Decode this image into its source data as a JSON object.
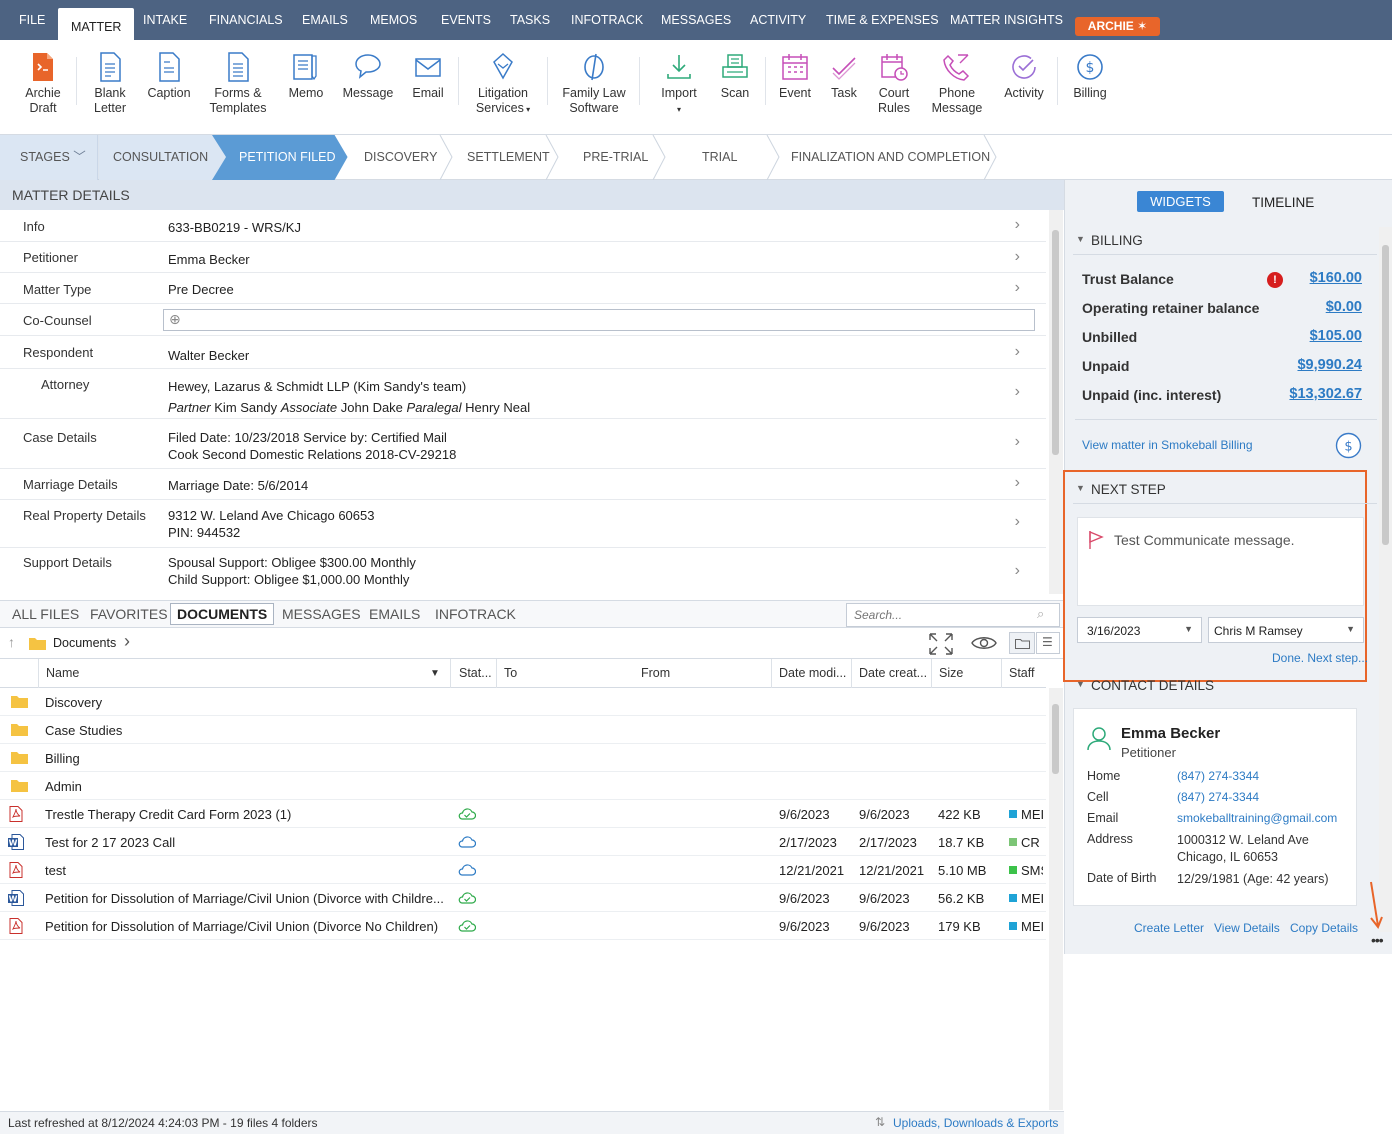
{
  "menu": {
    "tabs": [
      "FILE",
      "MATTER",
      "INTAKE",
      "FINANCIALS",
      "EMAILS",
      "MEMOS",
      "EVENTS",
      "TASKS",
      "INFOTRACK",
      "MESSAGES",
      "ACTIVITY",
      "TIME & EXPENSES",
      "MATTER INSIGHTS"
    ],
    "active": "MATTER",
    "archie": "ARCHIE"
  },
  "ribbon": {
    "archie_draft": [
      "Archie",
      "Draft"
    ],
    "blank_letter": [
      "Blank",
      "Letter"
    ],
    "caption": [
      "Caption",
      ""
    ],
    "forms_templates": [
      "Forms &",
      "Templates"
    ],
    "memo": [
      "Memo",
      ""
    ],
    "message": [
      "Message",
      ""
    ],
    "email": [
      "Email",
      ""
    ],
    "litigation_services": [
      "Litigation",
      "Services"
    ],
    "family_law_software": [
      "Family Law",
      "Software"
    ],
    "import": [
      "Import",
      ""
    ],
    "scan": [
      "Scan",
      ""
    ],
    "event": [
      "Event",
      ""
    ],
    "task": [
      "Task",
      ""
    ],
    "court_rules": [
      "Court",
      "Rules"
    ],
    "phone_message": [
      "Phone",
      "Message"
    ],
    "activity": [
      "Activity",
      ""
    ],
    "billing": [
      "Billing",
      ""
    ]
  },
  "stages": {
    "label": "STAGES",
    "items": [
      "CONSULTATION",
      "PETITION FILED",
      "DISCOVERY",
      "SETTLEMENT",
      "PRE-TRIAL",
      "TRIAL",
      "FINALIZATION AND COMPLETION"
    ],
    "active": "PETITION FILED"
  },
  "matter": {
    "header": "MATTER DETAILS",
    "info": {
      "label": "Info",
      "value": "633-BB0219 - WRS/KJ"
    },
    "petitioner": {
      "label": "Petitioner",
      "value": "Emma Becker"
    },
    "matter_type": {
      "label": "Matter Type",
      "value": "Pre Decree"
    },
    "co_counsel": {
      "label": "Co-Counsel"
    },
    "respondent": {
      "label": "Respondent",
      "value": "Walter Becker"
    },
    "attorney": {
      "label": "Attorney",
      "firm": "Hewey, Lazarus & Schmidt LLP (Kim Sandy's team)",
      "r1": "Partner",
      "n1": "Kim Sandy",
      "r2": "Associate",
      "n2": "John Dake",
      "r3": "Paralegal",
      "n3": "Henry Neal"
    },
    "case_details": {
      "label": "Case Details",
      "line1": "Filed Date: 10/23/2018  Service by: Certified Mail",
      "line2": "Cook Second Domestic Relations 2018-CV-29218"
    },
    "marriage_details": {
      "label": "Marriage Details",
      "value": "Marriage Date: 5/6/2014"
    },
    "real_property": {
      "label": "Real Property Details",
      "line1": "9312 W. Leland Ave Chicago 60653",
      "line2": "PIN: 944532"
    },
    "support": {
      "label": "Support Details",
      "line1": "Spousal Support: Obligee $300.00 Monthly",
      "line2": "Child Support: Obligee $1,000.00 Monthly"
    }
  },
  "files": {
    "tabs": [
      "ALL FILES",
      "FAVORITES",
      "DOCUMENTS",
      "MESSAGES",
      "EMAILS",
      "INFOTRACK"
    ],
    "active": "DOCUMENTS",
    "search_placeholder": "Search...",
    "crumb": "Documents",
    "columns": {
      "name": "Name",
      "status": "Stat...",
      "to": "To",
      "from": "From",
      "modified": "Date modi...",
      "created": "Date creat...",
      "size": "Size",
      "staff": "Staff"
    },
    "folders": [
      "Discovery",
      "Case Studies",
      "Billing",
      "Admin"
    ],
    "rows": [
      {
        "type": "pdf",
        "name": "Trestle Therapy Credit Card Form 2023 (1)",
        "status": "synced",
        "modified": "9/6/2023",
        "created": "9/6/2023",
        "size": "422 KB",
        "staff": "MEI",
        "staff_color": "#1fa3d6"
      },
      {
        "type": "word",
        "name": "Test for 2 17 2023 Call",
        "status": "cloud",
        "modified": "2/17/2023",
        "created": "2/17/2023",
        "size": "18.7 KB",
        "staff": "CR",
        "staff_color": "#7cc576"
      },
      {
        "type": "pdf",
        "name": "test",
        "status": "cloud",
        "modified": "12/21/2021",
        "created": "12/21/2021",
        "size": "5.10 MB",
        "staff": "SMS",
        "staff_color": "#3cc24a"
      },
      {
        "type": "word",
        "name": "Petition for Dissolution of Marriage/Civil Union (Divorce with Childre...",
        "status": "synced",
        "modified": "9/6/2023",
        "created": "9/6/2023",
        "size": "56.2 KB",
        "staff": "MEI",
        "staff_color": "#1fa3d6"
      },
      {
        "type": "pdf",
        "name": "Petition for Dissolution of Marriage/Civil Union (Divorce No Children)",
        "status": "synced",
        "modified": "9/6/2023",
        "created": "9/6/2023",
        "size": "179 KB",
        "staff": "MEI",
        "staff_color": "#1fa3d6"
      }
    ]
  },
  "status_bar": {
    "refreshed": "Last refreshed at 8/12/2024 4:24:03 PM  -  19 files  4 folders",
    "uploads": "Uploads, Downloads & Exports"
  },
  "widgets": {
    "tabs": {
      "widgets": "WIDGETS",
      "timeline": "TIMELINE"
    },
    "billing": {
      "header": "BILLING",
      "trust_label": "Trust Balance",
      "trust_value": "$160.00",
      "op_label": "Operating retainer balance",
      "op_value": "$0.00",
      "unbilled_label": "Unbilled",
      "unbilled_value": "$105.00",
      "unpaid_label": "Unpaid",
      "unpaid_value": "$9,990.24",
      "unpaid_int_label": "Unpaid (inc. interest)",
      "unpaid_int_value": "$13,302.67",
      "link": "View matter in Smokeball Billing"
    },
    "next_step": {
      "header": "NEXT STEP",
      "message": "Test Communicate message.",
      "date": "3/16/2023",
      "assignee": "Chris M Ramsey",
      "done": "Done. Next step..."
    },
    "contact": {
      "header": "CONTACT DETAILS",
      "name": "Emma Becker",
      "role": "Petitioner",
      "home_label": "Home",
      "home": "(847) 274-3344",
      "cell_label": "Cell",
      "cell": "(847) 274-3344",
      "email_label": "Email",
      "email": "smokeballtraining@gmail.com",
      "address_label": "Address",
      "address1": "1000312 W. Leland Ave",
      "address2": "Chicago, IL 60653",
      "dob_label": "Date of Birth",
      "dob": "12/29/1981 (Age: 42 years)",
      "create_letter": "Create Letter",
      "view_details": "View Details",
      "copy_details": "Copy Details"
    }
  },
  "colors": {
    "menubar": "#4d6382",
    "accent_orange": "#e8652a",
    "stage_active": "#5b9bd5",
    "stage_prior": "#dbe6f3",
    "link": "#2d7bc4"
  }
}
